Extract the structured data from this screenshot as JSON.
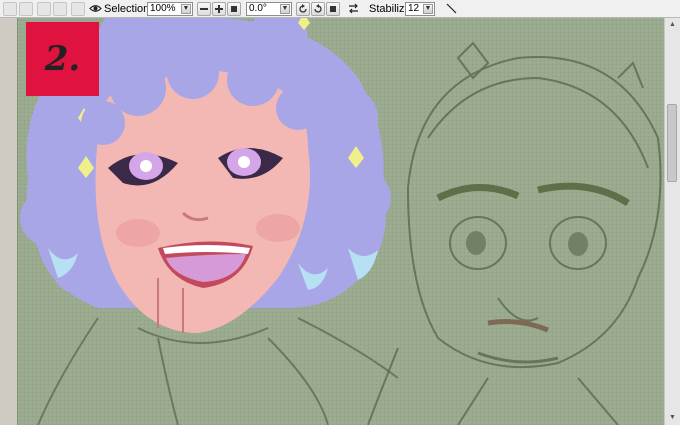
{
  "toolbar": {
    "selection_label": "Selection",
    "zoom_value": "100%",
    "rotation_value": "0.0°",
    "stabilizer_label": "Stabilizer",
    "stabilizer_value": "12"
  },
  "canvas": {
    "badge_text": "2."
  },
  "colors": {
    "canvas_bg": "#9aaa8e",
    "badge_bg": "#e0123f",
    "hair": "#a8a6e6",
    "skin": "#f4b8b4",
    "sketch": "#5e6e52"
  }
}
